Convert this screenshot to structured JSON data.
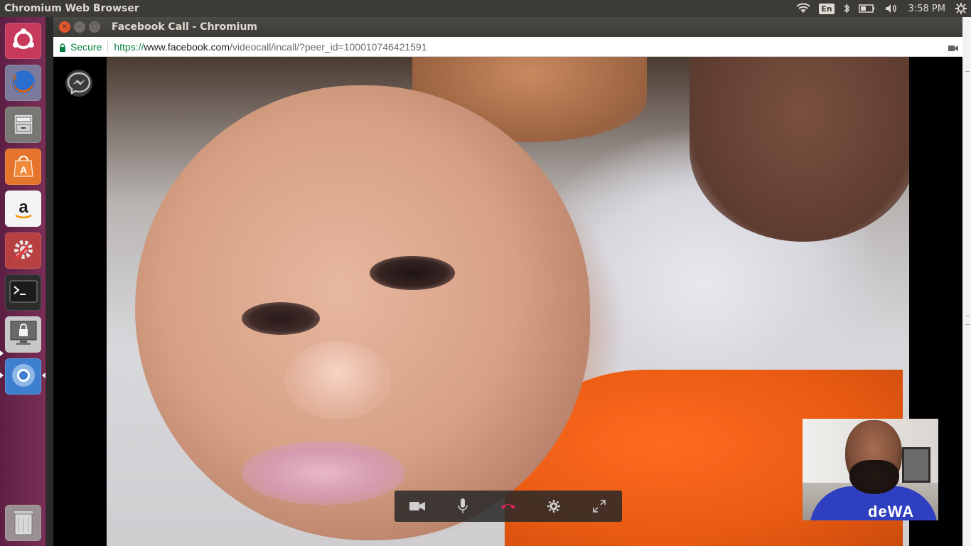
{
  "top_panel": {
    "app_title": "Chromium Web Browser",
    "keyboard_layout": "En",
    "clock": "3:58 PM",
    "indicators": [
      "wifi-icon",
      "keyboard-layout-indicator",
      "bluetooth-icon",
      "battery-icon",
      "volume-icon",
      "clock",
      "settings-gear-icon"
    ]
  },
  "launcher": {
    "items": [
      {
        "name": "ubuntu-dash",
        "icon": "ubuntu-logo-icon",
        "color": "#c83a5c"
      },
      {
        "name": "firefox",
        "icon": "firefox-icon",
        "color": "#e66000"
      },
      {
        "name": "files",
        "icon": "file-cabinet-icon",
        "color": "#6b6b6b"
      },
      {
        "name": "software-center",
        "icon": "shopping-bag-icon",
        "color": "#e5742d"
      },
      {
        "name": "amazon",
        "icon": "amazon-icon",
        "color": "#f4f4f4"
      },
      {
        "name": "system-settings",
        "icon": "wrench-gear-icon",
        "color": "#b74040"
      },
      {
        "name": "terminal",
        "icon": "terminal-icon",
        "color": "#2d2d2d"
      },
      {
        "name": "screen-lock",
        "icon": "lock-screen-icon",
        "color": "#c8c8c8"
      },
      {
        "name": "chromium",
        "icon": "chromium-icon",
        "color": "#3f7fd0"
      },
      {
        "name": "trash",
        "icon": "trash-icon",
        "color": "#9a8f93"
      }
    ]
  },
  "window": {
    "title": "Facebook Call - Chromium",
    "controls": {
      "close": "×",
      "minimize": "–",
      "maximize": "□"
    }
  },
  "omnibox": {
    "secure_label": "Secure",
    "url_scheme": "https://",
    "url_host": "www.facebook.com",
    "url_path": "/videocall/incall/?peer_id=100010746421591"
  },
  "call": {
    "self_view_shirt_text": "deWA",
    "controls": [
      {
        "name": "video-toggle",
        "icon": "video-camera-icon"
      },
      {
        "name": "mic-toggle",
        "icon": "microphone-icon"
      },
      {
        "name": "end-call",
        "icon": "hang-up-icon",
        "color": "#e0245e"
      },
      {
        "name": "settings",
        "icon": "gear-icon"
      },
      {
        "name": "fullscreen",
        "icon": "expand-icon"
      }
    ]
  },
  "colors": {
    "panel_bg": "#3c3b37",
    "launcher_bg": "#7a2f55",
    "secure_green": "#0b8043",
    "close_button": "#e5562a",
    "hangup_red": "#e0245e"
  }
}
